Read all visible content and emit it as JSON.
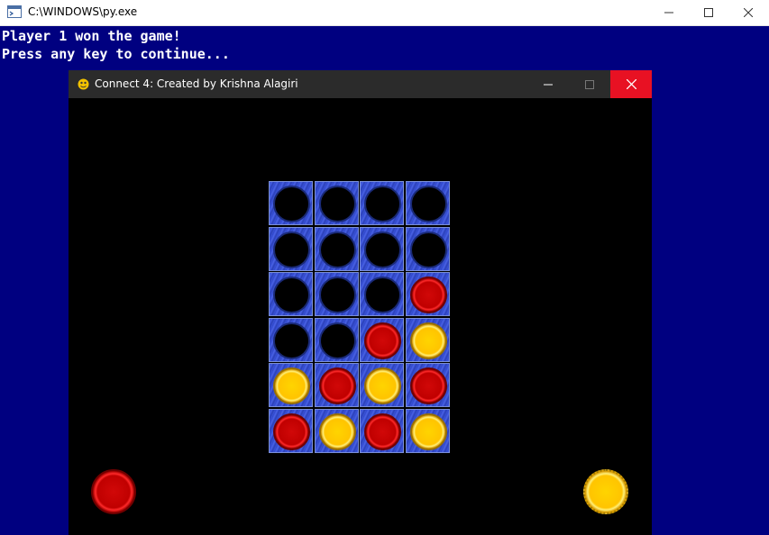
{
  "console": {
    "title": "C:\\WINDOWS\\py.exe",
    "lines": [
      "Player 1 won the game!",
      "Press any key to continue..."
    ]
  },
  "game_window": {
    "title": "Connect 4: Created by Krishna Alagiri"
  },
  "board": {
    "rows": 6,
    "cols": 4,
    "cells": [
      [
        "empty",
        "empty",
        "empty",
        "empty"
      ],
      [
        "empty",
        "empty",
        "empty",
        "empty"
      ],
      [
        "empty",
        "empty",
        "empty",
        "red"
      ],
      [
        "empty",
        "empty",
        "red",
        "yellow"
      ],
      [
        "yellow",
        "red",
        "yellow",
        "red"
      ],
      [
        "red",
        "yellow",
        "red",
        "yellow"
      ]
    ]
  },
  "players": [
    {
      "side": "left",
      "color": "red"
    },
    {
      "side": "right",
      "color": "yellow"
    }
  ],
  "colors": {
    "console_bg": "#000080",
    "red": "#c00000",
    "yellow": "#ffc400",
    "board_blue": "#3c56d8"
  }
}
